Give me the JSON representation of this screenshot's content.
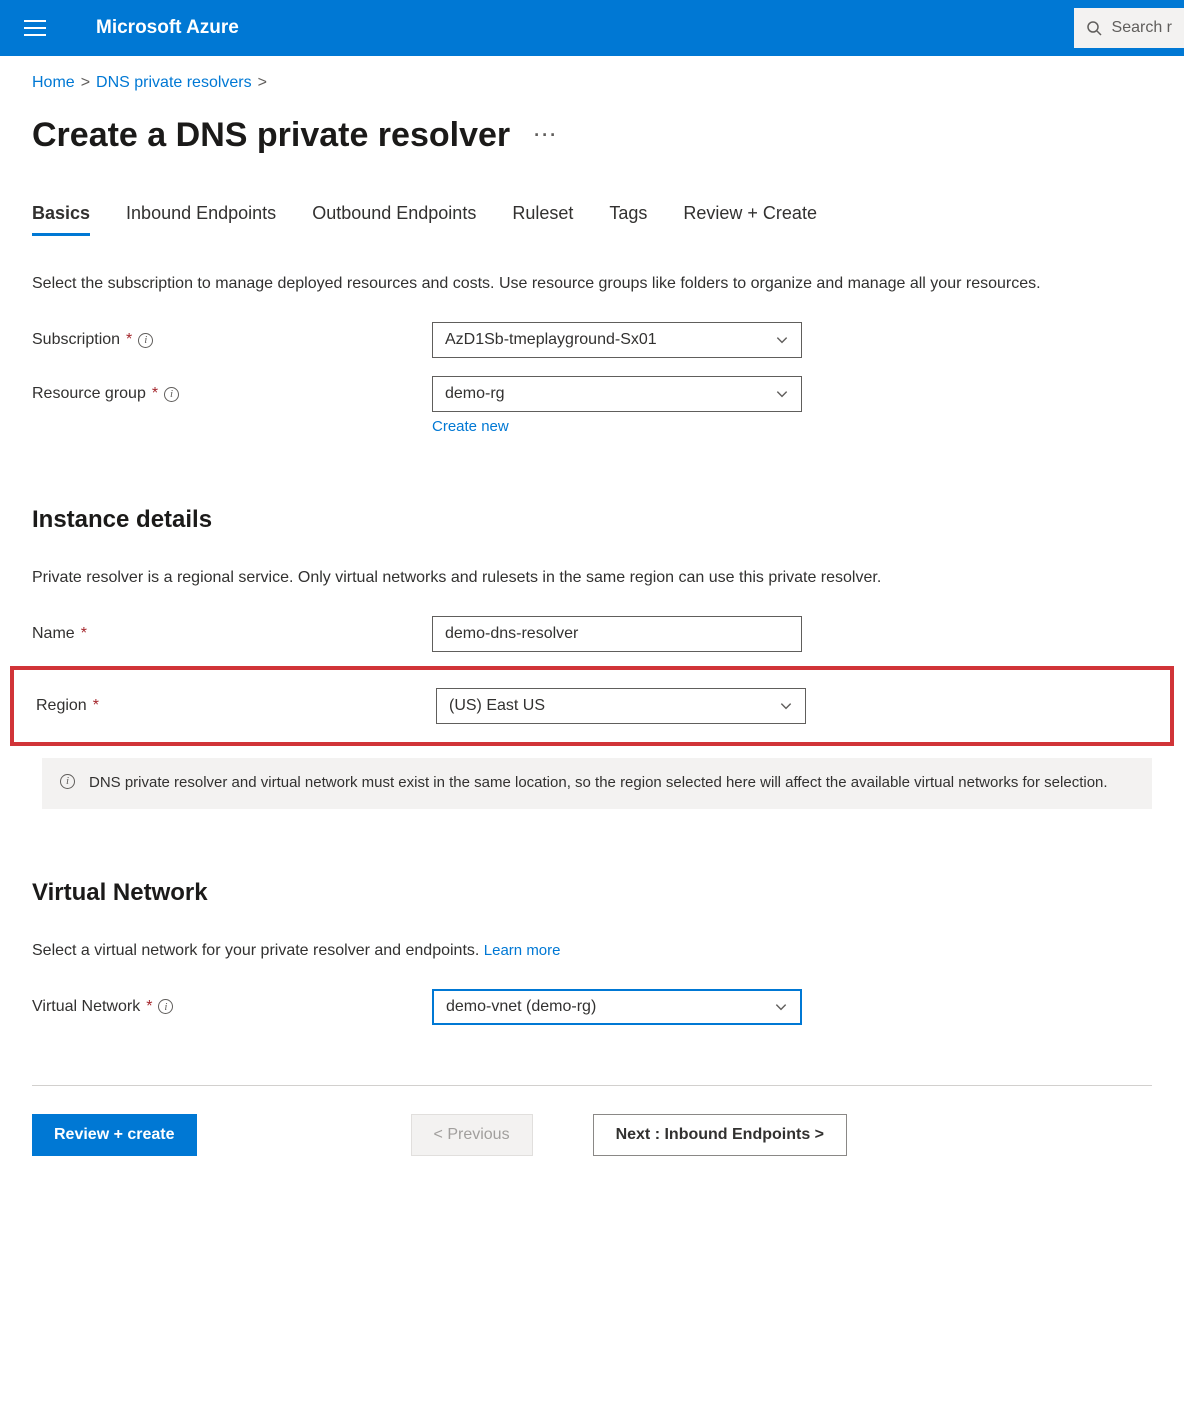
{
  "brand": "Microsoft Azure",
  "search_placeholder": "Search r",
  "breadcrumb": {
    "home": "Home",
    "resolvers": "DNS private resolvers"
  },
  "page_title": "Create a DNS private resolver",
  "tabs": {
    "basics": "Basics",
    "inbound": "Inbound Endpoints",
    "outbound": "Outbound Endpoints",
    "ruleset": "Ruleset",
    "tags": "Tags",
    "review": "Review + Create"
  },
  "basics_desc": "Select the subscription to manage deployed resources and costs. Use resource groups like folders to organize and manage all your resources.",
  "fields": {
    "subscription_label": "Subscription",
    "subscription_value": "AzD1Sb-tmeplayground-Sx01",
    "resource_group_label": "Resource group",
    "resource_group_value": "demo-rg",
    "create_new": "Create new"
  },
  "instance": {
    "heading": "Instance details",
    "desc": "Private resolver is a regional service. Only virtual networks and rulesets in the same region can use this private resolver.",
    "name_label": "Name",
    "name_value": "demo-dns-resolver",
    "region_label": "Region",
    "region_value": "(US) East US",
    "info_banner": "DNS private resolver and virtual network must exist in the same location, so the region selected here will affect the available virtual networks for selection."
  },
  "vnet": {
    "heading": "Virtual Network",
    "desc": "Select a virtual network for your private resolver and endpoints. ",
    "learn_more": "Learn more",
    "label": "Virtual Network",
    "value": "demo-vnet (demo-rg)"
  },
  "footer": {
    "review": "Review + create",
    "previous": "< Previous",
    "next": "Next : Inbound Endpoints >"
  }
}
